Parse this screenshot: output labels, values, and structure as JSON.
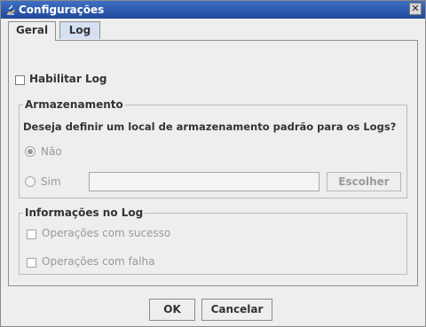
{
  "window": {
    "title": "Configurações",
    "close_symbol": "✕"
  },
  "tabs": [
    {
      "label": "Geral",
      "active": true
    },
    {
      "label": "Log",
      "active": false
    }
  ],
  "enable_log": {
    "label": "Habilitar Log",
    "checked": false
  },
  "storage": {
    "title": "Armazenamento",
    "question": "Deseja definir um local de armazenamento padrão para os Logs?",
    "option_no": {
      "label": "Não",
      "selected": true,
      "enabled": false
    },
    "option_yes": {
      "label": "Sim",
      "selected": false,
      "enabled": false
    },
    "path_value": "",
    "choose_button": "Escolher"
  },
  "log_info": {
    "title": "Informações no Log",
    "success": {
      "label": "Operações com sucesso",
      "checked": false,
      "enabled": false
    },
    "failure": {
      "label": "Operações com falha",
      "checked": false,
      "enabled": false
    }
  },
  "footer": {
    "ok_label": "OK",
    "cancel_label": "Cancelar"
  },
  "colors": {
    "titlebar": "#20489a",
    "active_tab_bg": "#eeeeee",
    "inactive_tab_bg": "#d5e0f2"
  }
}
